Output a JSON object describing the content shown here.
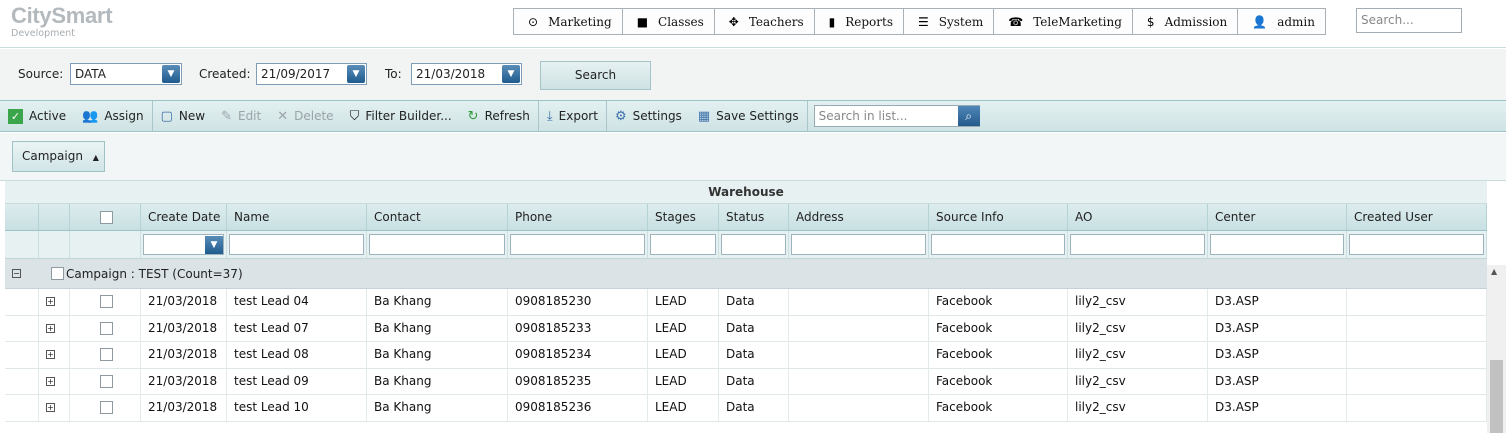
{
  "brand": {
    "title": "CitySmart",
    "subtitle": "Development"
  },
  "menu": [
    {
      "icon": "⊙",
      "label": "Marketing"
    },
    {
      "icon": "■",
      "label": "Classes"
    },
    {
      "icon": "✥",
      "label": "Teachers"
    },
    {
      "icon": "▮",
      "label": "Reports"
    },
    {
      "icon": "☰",
      "label": "System"
    },
    {
      "icon": "☎",
      "label": "TeleMarketing"
    },
    {
      "icon": "$",
      "label": "Admission"
    },
    {
      "icon": "👤",
      "label": "admin"
    }
  ],
  "top_search": {
    "placeholder": "Search..."
  },
  "filters": {
    "source_label": "Source:",
    "source_value": "DATA",
    "created_label": "Created:",
    "created_value": "21/09/2017",
    "to_label": "To:",
    "to_value": "21/03/2018",
    "search_button": "Search"
  },
  "toolbar": {
    "active": "Active",
    "assign": "Assign",
    "new": "New",
    "edit": "Edit",
    "delete": "Delete",
    "filter_builder": "Filter Builder...",
    "refresh": "Refresh",
    "export": "Export",
    "settings": "Settings",
    "save_settings": "Save Settings",
    "list_search_placeholder": "Search in list..."
  },
  "group_chip": "Campaign",
  "band_title": "Warehouse",
  "columns": [
    "Create Date",
    "Name",
    "Contact",
    "Phone",
    "Stages",
    "Status",
    "Address",
    "Source Info",
    "AO",
    "Center",
    "Created User"
  ],
  "group_row": "Campaign : TEST (Count=37)",
  "rows": [
    {
      "date": "21/03/2018",
      "name": "test Lead 04",
      "contact": "Ba Khang",
      "phone": "0908185230",
      "stage": "LEAD",
      "status": "Data",
      "address": "",
      "source": "Facebook",
      "ao": "lily2_csv",
      "center": "D3.ASP",
      "user": ""
    },
    {
      "date": "21/03/2018",
      "name": "test Lead 07",
      "contact": "Ba Khang",
      "phone": "0908185233",
      "stage": "LEAD",
      "status": "Data",
      "address": "",
      "source": "Facebook",
      "ao": "lily2_csv",
      "center": "D3.ASP",
      "user": ""
    },
    {
      "date": "21/03/2018",
      "name": "test Lead 08",
      "contact": "Ba Khang",
      "phone": "0908185234",
      "stage": "LEAD",
      "status": "Data",
      "address": "",
      "source": "Facebook",
      "ao": "lily2_csv",
      "center": "D3.ASP",
      "user": ""
    },
    {
      "date": "21/03/2018",
      "name": "test Lead 09",
      "contact": "Ba Khang",
      "phone": "0908185235",
      "stage": "LEAD",
      "status": "Data",
      "address": "",
      "source": "Facebook",
      "ao": "lily2_csv",
      "center": "D3.ASP",
      "user": ""
    },
    {
      "date": "21/03/2018",
      "name": "test Lead 10",
      "contact": "Ba Khang",
      "phone": "0908185236",
      "stage": "LEAD",
      "status": "Data",
      "address": "",
      "source": "Facebook",
      "ao": "lily2_csv",
      "center": "D3.ASP",
      "user": ""
    }
  ]
}
